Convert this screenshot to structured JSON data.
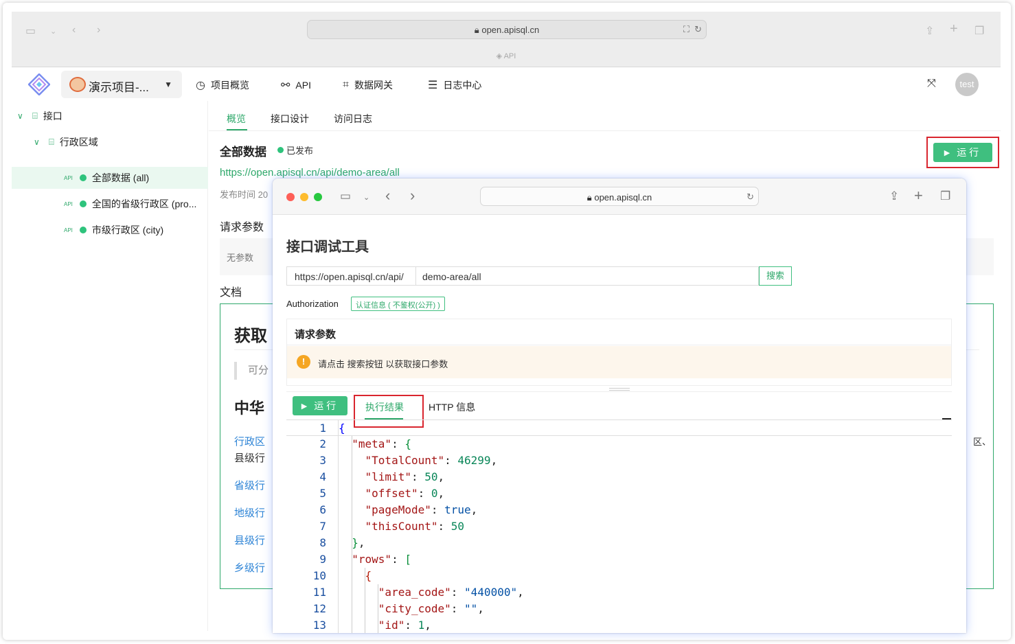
{
  "browser": {
    "url": "open.apisql.cn",
    "tab_label": "API"
  },
  "app": {
    "project_name": "演示项目-...",
    "nav": [
      {
        "label": "项目概览",
        "icon": "dashboard-icon"
      },
      {
        "label": "API",
        "icon": "link-icon"
      },
      {
        "label": "数据网关",
        "icon": "gateway-icon"
      },
      {
        "label": "日志中心",
        "icon": "log-icon"
      }
    ],
    "user_avatar": "test"
  },
  "sidebar": {
    "root": "接口",
    "group": "行政区域",
    "api_tag": "API",
    "items": [
      {
        "label": "全部数据 (all)",
        "active": true
      },
      {
        "label": "全国的省级行政区 (pro...",
        "active": false
      },
      {
        "label": "市级行政区 (city)",
        "active": false
      }
    ]
  },
  "main": {
    "tabs": [
      "概览",
      "接口设计",
      "访问日志"
    ],
    "api_title": "全部数据",
    "status": "已发布",
    "api_url": "https://open.apisql.cn/api/demo-area/all",
    "publish_time": "发布时间 20",
    "request_params_label": "请求参数",
    "no_params": "无参数",
    "docs_label": "文档",
    "run_label": "运行",
    "doc": {
      "h1": "获取",
      "quote": "可分",
      "h2": "中华",
      "link1": "行政区",
      "text1": "县级行",
      "link2": "省级行",
      "link3": "地级行",
      "link4": "县级行",
      "link5": "乡级行",
      "tail": "区、"
    }
  },
  "popup": {
    "url": "open.apisql.cn",
    "title": "接口调试工具",
    "url_prefix": "https://open.apisql.cn/api/",
    "url_path": "demo-area/all",
    "search_label": "搜索",
    "auth_label": "Authorization",
    "auth_tag": "认证信息 ( 不鉴权(公开) )",
    "params_title": "请求参数",
    "params_warning": "请点击 搜索按钮 以获取接口参数",
    "run_label": "运行",
    "result_tabs": [
      "执行结果",
      "HTTP 信息"
    ],
    "code_lines": [
      "1",
      "2",
      "3",
      "4",
      "5",
      "6",
      "7",
      "8",
      "9",
      "10",
      "11",
      "12",
      "13"
    ],
    "json": {
      "meta_key": "\"meta\"",
      "total_key": "\"TotalCount\"",
      "total_val": "46299",
      "limit_key": "\"limit\"",
      "limit_val": "50",
      "offset_key": "\"offset\"",
      "offset_val": "0",
      "pagemode_key": "\"pageMode\"",
      "pagemode_val": "true",
      "thiscount_key": "\"thisCount\"",
      "thiscount_val": "50",
      "rows_key": "\"rows\"",
      "area_key": "\"area_code\"",
      "area_val": "\"440000\"",
      "city_key": "\"city_code\"",
      "city_val": "\"\"",
      "id_key": "\"id\"",
      "id_val": "1"
    }
  }
}
